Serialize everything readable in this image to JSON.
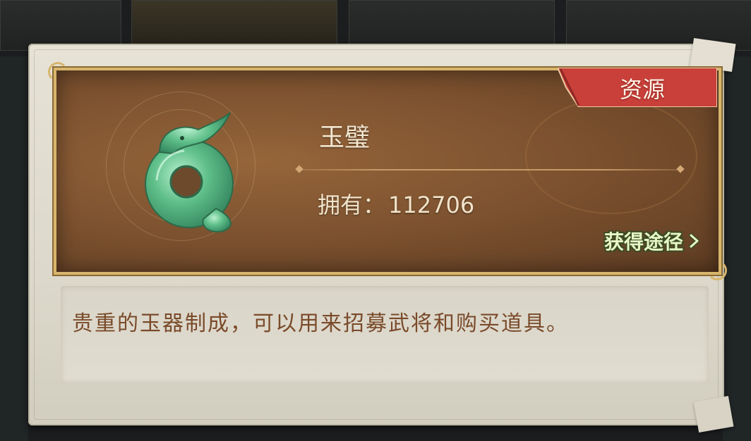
{
  "item": {
    "name": "玉璧",
    "owned_label": "拥有：",
    "owned_count": "112706",
    "category_tag": "资源",
    "obtain_label": "获得途径",
    "description": "贵重的玉器制成，可以用来招募武将和购买道具。"
  },
  "icons": {
    "item_icon": "jade-dragon-bi-icon",
    "obtain_arrow": "chevron-right-icon"
  },
  "colors": {
    "plate_gold_border": "#d7b56c",
    "plate_brown": "#7e5330",
    "ribbon_red": "#c9403b",
    "obtain_green": "#e6f7c5",
    "description_brown": "#7a4a2a",
    "jade_green": "#5fbf8a"
  }
}
